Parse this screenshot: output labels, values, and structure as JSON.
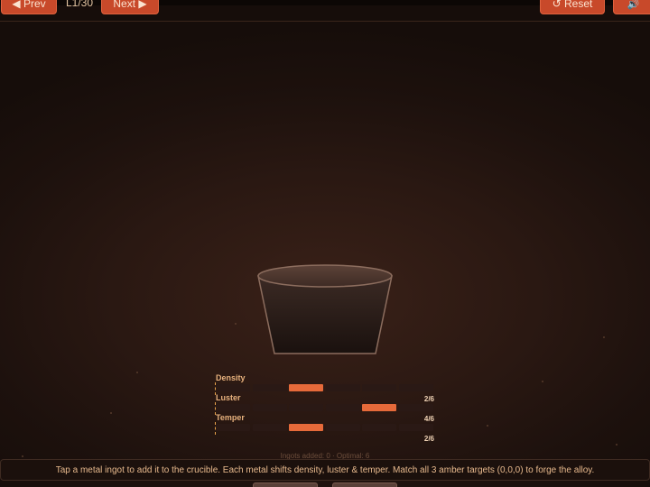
{
  "toolbar": {
    "prev_label": "◀ Prev",
    "level_label": "L1/30",
    "next_label": "Next ▶",
    "reset_label": "↺ Reset",
    "sound_icon": "speaker-icon"
  },
  "meters": [
    {
      "label": "Density",
      "value": "2/6",
      "level": 2,
      "max": 6
    },
    {
      "label": "Luster",
      "value": "4/6",
      "level": 4,
      "max": 6
    },
    {
      "label": "Temper",
      "value": "2/6",
      "level": 2,
      "max": 6
    }
  ],
  "ingots_info": "Ingots added: 0 · Optimal: 6",
  "hint": "Tap a metal ingot to add it to the crucible. Each metal shifts density, luster & temper. Match all 3 amber targets (0,0,0) to forge the alloy.",
  "colors": {
    "accent": "#c8492a",
    "meter_fill": "#e66a3a",
    "target_marker": "#e8a24a"
  }
}
